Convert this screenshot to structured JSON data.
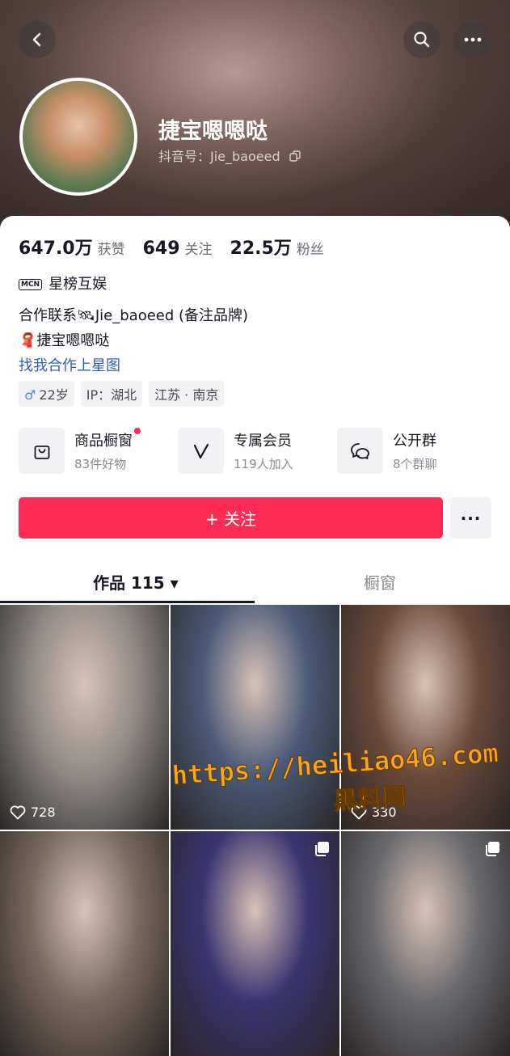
{
  "profile": {
    "name": "捷宝嗯嗯哒",
    "douyin_id": "抖音号：Jie_baoeed"
  },
  "stats": [
    {
      "value": "647.0万",
      "label": "获赞"
    },
    {
      "value": "649",
      "label": "关注"
    },
    {
      "value": "22.5万",
      "label": "粉丝"
    }
  ],
  "bio": {
    "mcn_badge": "MCN",
    "agency": "星榜互娱",
    "line1": "合作联系🛰Jie_baoeed (备注品牌)",
    "line2": "🧣捷宝嗯嗯哒",
    "link": "找我合作上星图"
  },
  "tags": [
    {
      "icon": "♂",
      "text": "22岁"
    },
    {
      "text": "IP：湖北"
    },
    {
      "text": "江苏 · 南京"
    }
  ],
  "features": [
    {
      "icon": "bag-icon",
      "title": "商品橱窗",
      "subtitle": "83件好物"
    },
    {
      "icon": "v-badge-icon",
      "title": "专属会员",
      "subtitle": "119人加入"
    },
    {
      "icon": "chat-icon",
      "title": "公开群",
      "subtitle": "8个群聊"
    }
  ],
  "actions": {
    "follow_label": "+ 关注",
    "more_label": "···"
  },
  "tabs": {
    "works": "作品 115 ▾",
    "showcase": "橱窗"
  },
  "videos": [
    {
      "likes": "728",
      "pinned": false,
      "color": "#8f8a86"
    },
    {
      "likes": "",
      "pinned": false,
      "color": "#4a5a78"
    },
    {
      "likes": "330",
      "pinned": false,
      "color": "#6b4a3a"
    },
    {
      "likes": "",
      "pinned": false,
      "color": "#7a6a5e"
    },
    {
      "likes": "",
      "pinned": true,
      "color": "#3a3470"
    },
    {
      "likes": "",
      "pinned": true,
      "color": "#6a6a6e"
    }
  ],
  "watermark": {
    "line1": "https://heiliao46.com",
    "line2": "黑料网"
  },
  "colors": {
    "accent": "#fe2c55",
    "link": "#2f5fa8"
  }
}
